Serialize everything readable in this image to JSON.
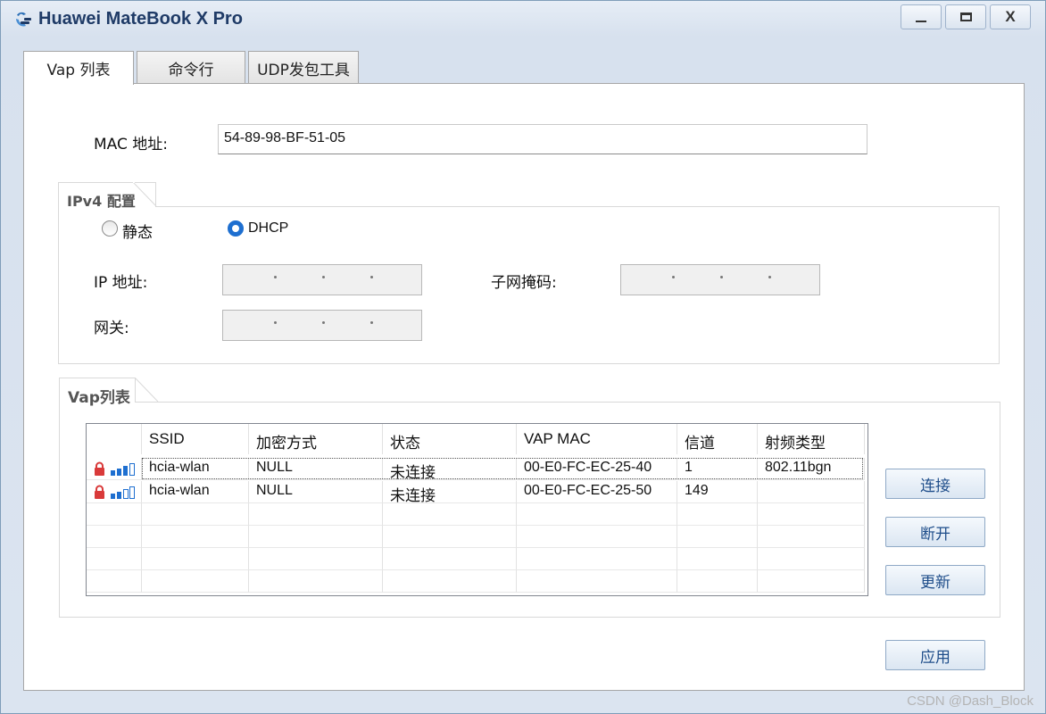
{
  "window": {
    "title": "Huawei MateBook X Pro",
    "minimize": "—",
    "maximize": "☐",
    "close": "X"
  },
  "tabs": [
    {
      "label": "Vap 列表"
    },
    {
      "label": "命令行"
    },
    {
      "label": "UDP发包工具"
    }
  ],
  "mac": {
    "label": "MAC 地址:",
    "value": "54-89-98-BF-51-05"
  },
  "ipv4": {
    "group_title": "IPv4 配置",
    "static_label": "静态",
    "dhcp_label": "DHCP",
    "selected": "DHCP",
    "ip_label": "IP 地址:",
    "subnet_label": "子网掩码:",
    "gateway_label": "网关:"
  },
  "vap": {
    "group_title": "Vap列表",
    "columns": [
      "SSID",
      "加密方式",
      "状态",
      "VAP MAC",
      "信道",
      "射频类型"
    ],
    "rows": [
      {
        "ssid": "hcia-wlan",
        "encryption": "NULL",
        "status": "未连接",
        "vap_mac": "00-E0-FC-EC-25-40",
        "channel": "1",
        "radio": "802.11bgn"
      },
      {
        "ssid": "hcia-wlan",
        "encryption": "NULL",
        "status": "未连接",
        "vap_mac": "00-E0-FC-EC-25-50",
        "channel": "149",
        "radio": ""
      }
    ]
  },
  "buttons": {
    "connect": "连接",
    "disconnect": "断开",
    "refresh": "更新",
    "apply": "应用"
  },
  "colors": {
    "accent": "#1e6fd0",
    "title": "#1f3b67",
    "lock": "#d93a3a"
  },
  "watermark": "CSDN @Dash_Block"
}
